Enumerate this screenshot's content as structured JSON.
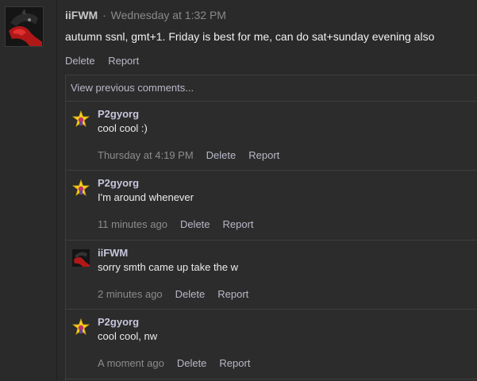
{
  "post": {
    "author": "iiFWM",
    "separator": "·",
    "time": "Wednesday at 1:32 PM",
    "body": "autumn ssnl, gmt+1. Friday is best for me, can do sat+sunday evening also",
    "actions": {
      "delete": "Delete",
      "report": "Report"
    }
  },
  "comments_panel": {
    "view_previous": "View previous comments..."
  },
  "comments": [
    {
      "author": "P2gyorg",
      "avatar": "star-avatar-icon",
      "text": "cool cool :)",
      "time": "Thursday at 4:19 PM",
      "delete": "Delete",
      "report": "Report"
    },
    {
      "author": "P2gyorg",
      "avatar": "star-avatar-icon",
      "text": "I'm around whenever",
      "time": "11 minutes ago",
      "delete": "Delete",
      "report": "Report"
    },
    {
      "author": "iiFWM",
      "avatar": "dragon-avatar-icon",
      "text": "sorry smth came up take the w",
      "time": "2 minutes ago",
      "delete": "Delete",
      "report": "Report"
    },
    {
      "author": "P2gyorg",
      "avatar": "star-avatar-icon",
      "text": "cool cool, nw",
      "time": "A moment ago",
      "delete": "Delete",
      "report": "Report"
    }
  ],
  "colors": {
    "background": "#2a2a2a",
    "panel": "#2c2c2c",
    "link": "#b9b9c8",
    "muted": "#8c8c8c",
    "text": "#ececec"
  }
}
